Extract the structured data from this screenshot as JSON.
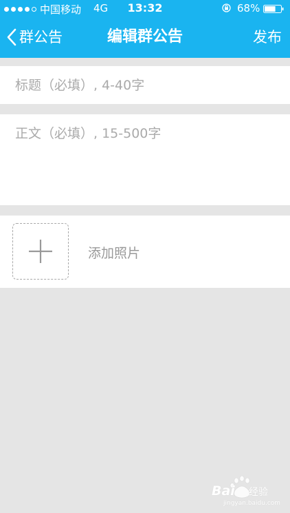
{
  "status_bar": {
    "signal_bars_filled": 4,
    "signal_bars_total": 5,
    "carrier": "中国移动",
    "network": "4G",
    "time": "13:32",
    "battery_percent": "68%",
    "battery_level": 0.68,
    "lock_icon": "orientation-lock-icon",
    "battery_icon": "battery-icon"
  },
  "nav": {
    "back_label": "群公告",
    "back_icon": "chevron-left-icon",
    "title": "编辑群公告",
    "publish_label": "发布"
  },
  "form": {
    "title_placeholder": "标题（必填）, 4-40字",
    "body_placeholder": "正文（必填）, 15-500字",
    "add_photo_label": "添加照片",
    "add_photo_icon": "plus-icon"
  },
  "watermark": {
    "brand": "Bai",
    "brand_suffix": "经验",
    "url": "jingyan.baidu.com"
  },
  "colors": {
    "header_bg": "#1ab4f0",
    "page_bg": "#e5e5e5",
    "placeholder": "#aaaaaa"
  }
}
